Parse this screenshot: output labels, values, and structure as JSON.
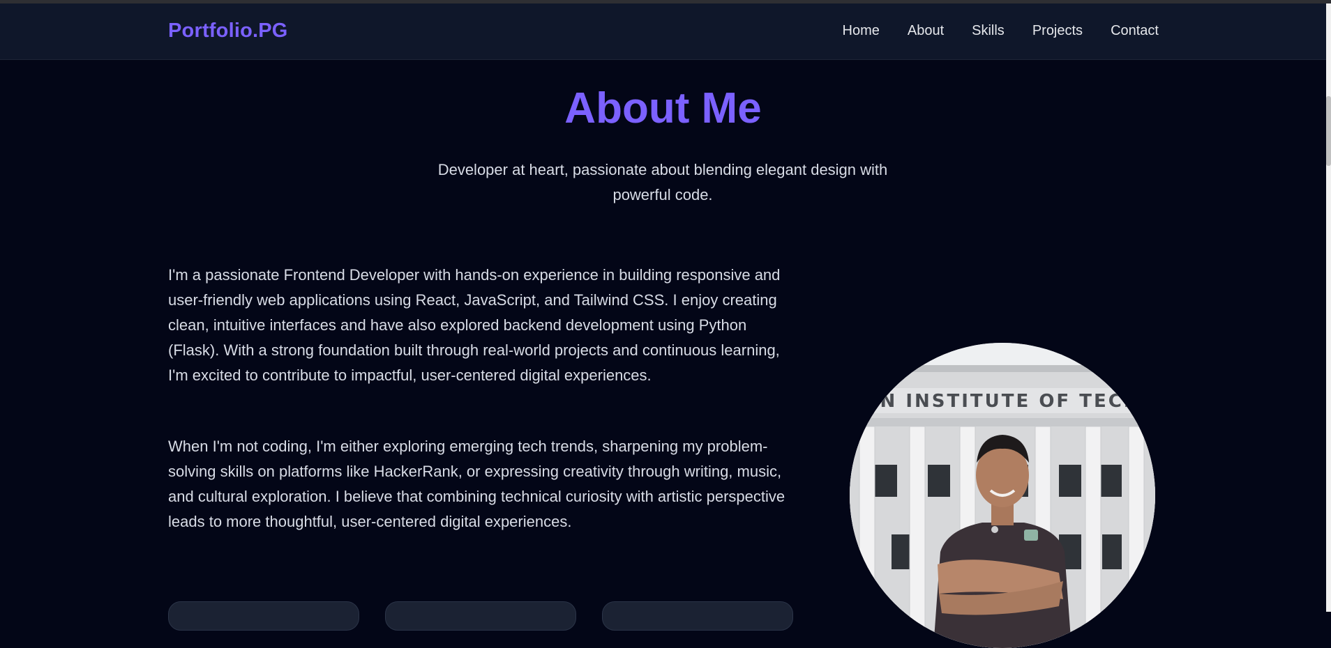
{
  "header": {
    "brand": "Portfolio.PG",
    "nav": [
      {
        "label": "Home"
      },
      {
        "label": "About"
      },
      {
        "label": "Skills"
      },
      {
        "label": "Projects"
      },
      {
        "label": "Contact"
      }
    ]
  },
  "about": {
    "title": "About Me",
    "subtitle": "Developer at heart, passionate about blending elegant design with powerful code.",
    "paragraphs": [
      "I'm a passionate Frontend Developer with hands-on experience in building responsive and user-friendly web applications using React, JavaScript, and Tailwind CSS. I enjoy creating clean, intuitive interfaces and have also explored backend development using Python (Flask). With a strong foundation built through real-world projects and continuous learning, I'm excited to contribute to impactful, user-centered digital experiences.",
      "When I'm not coding, I'm either exploring emerging tech trends, sharpening my problem-solving skills on platforms like HackerRank, or expressing creativity through writing, music, and cultural exploration. I believe that combining technical curiosity with artistic perspective leads to more thoughtful, user-centered digital experiences."
    ],
    "photo_sign_text": "AN  INSTITUTE  OF  TECH"
  },
  "colors": {
    "accent": "#7b61ff",
    "background": "#030617",
    "navbar": "#0f172a",
    "text": "#d8dce6"
  }
}
